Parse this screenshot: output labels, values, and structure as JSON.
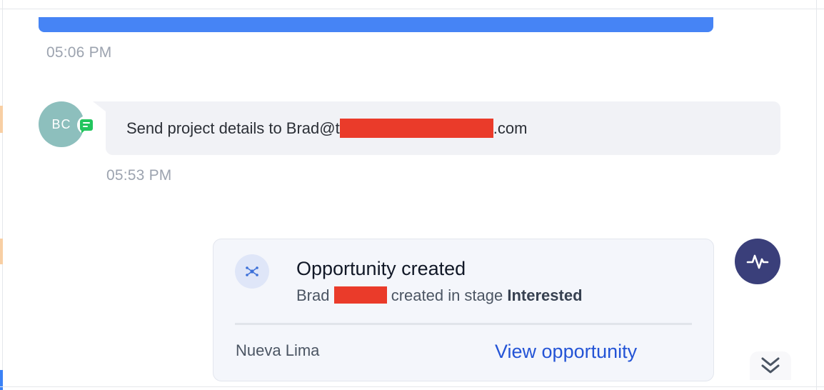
{
  "messages": {
    "prev_timestamp": "05:06 PM",
    "chat": {
      "avatar_initials": "BC",
      "text_before": "Send project details to Brad@t",
      "text_after": ".com",
      "timestamp": "05:53 PM"
    }
  },
  "opportunity_card": {
    "title": "Opportunity created",
    "sub_name": "Brad ",
    "sub_middle": " created in stage ",
    "stage": "Interested",
    "location": "Nueva Lima",
    "link_label": "View opportunity"
  },
  "icons": {
    "chat_badge": "chat-icon",
    "opportunity": "opportunity-icon",
    "activity": "activity-pulse-icon",
    "scroll": "double-chevron-down-icon"
  },
  "colors": {
    "accent_blue": "#4684f5",
    "link_blue": "#2454d6",
    "avatar_bg": "#8dbfbd",
    "activity_bg": "#3a3f7a",
    "redaction": "#ea3b2a"
  }
}
